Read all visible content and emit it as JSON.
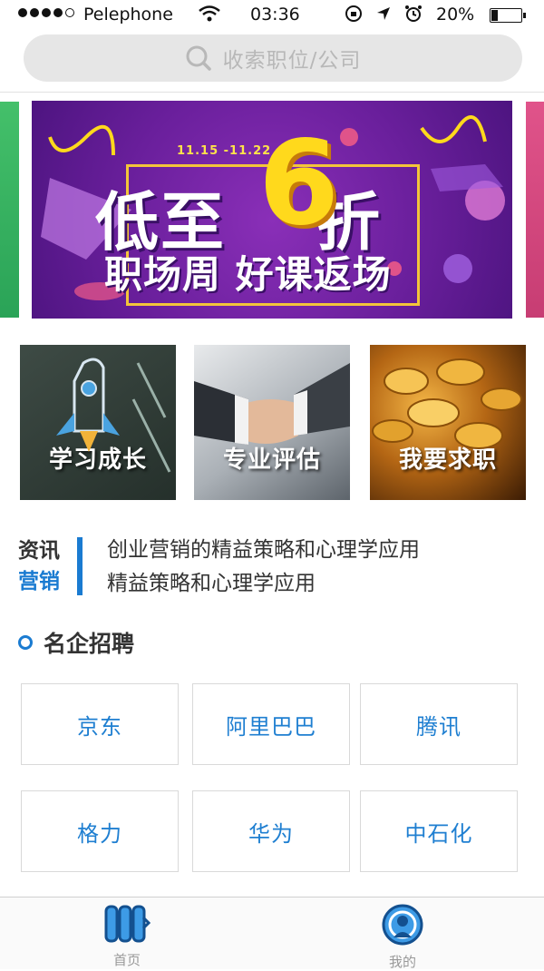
{
  "status_bar": {
    "carrier": "Pelephone",
    "time": "03:36",
    "battery": "20%"
  },
  "search": {
    "placeholder": "收索职位/公司"
  },
  "banner": {
    "date": "11.15 -11.22",
    "headline_left": "低至",
    "headline_number": "6",
    "headline_right": "折",
    "subline": "职场周 好课返场",
    "colors": {
      "background": "#6a1f9c",
      "accent": "#ffd91c"
    }
  },
  "categories": [
    {
      "label": "学习成长"
    },
    {
      "label": "专业评估"
    },
    {
      "label": "我要求职"
    }
  ],
  "news": {
    "label_line1": "资讯",
    "label_line2": "营销",
    "lines": [
      "创业营销的精益策略和心理学应用",
      "精益策略和心理学应用"
    ]
  },
  "section": {
    "title": "名企招聘"
  },
  "companies": [
    "京东",
    "阿里巴巴",
    "腾讯",
    "格力",
    "华为",
    "中石化"
  ],
  "tabs": [
    {
      "label": "首页",
      "icon": "home-icon"
    },
    {
      "label": "我的",
      "icon": "profile-icon"
    }
  ],
  "theme": {
    "accent": "#1a7bd1"
  }
}
